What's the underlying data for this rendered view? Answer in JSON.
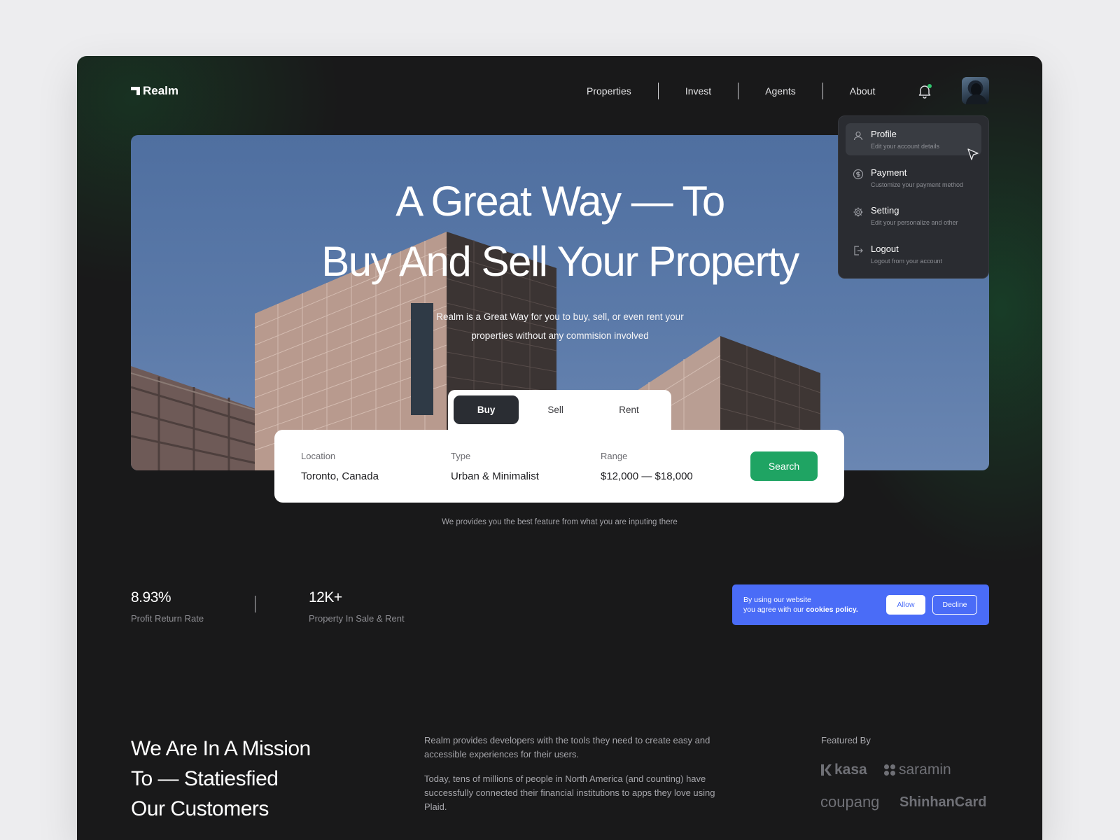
{
  "header": {
    "brand": "Realm",
    "nav": [
      "Properties",
      "Invest",
      "Agents",
      "About"
    ]
  },
  "hero": {
    "title_line1": "A Great Way — To",
    "title_line2": "Buy And Sell Your Property",
    "subtitle": "Realm is a Great Way for you to buy, sell, or even rent your properties without any commision involved"
  },
  "search": {
    "tabs": [
      "Buy",
      "Sell",
      "Rent"
    ],
    "active_tab": "Buy",
    "location_label": "Location",
    "location_value": "Toronto, Canada",
    "type_label": "Type",
    "type_value": "Urban & Minimalist",
    "range_label": "Range",
    "range_value": "$12,000 — $18,000",
    "button": "Search",
    "note": "We provides you the best feature from what you are inputing there"
  },
  "menu": {
    "items": [
      {
        "title": "Profile",
        "desc": "Edit your account details",
        "icon": "user-icon"
      },
      {
        "title": "Payment",
        "desc": "Customize your payment method",
        "icon": "dollar-icon"
      },
      {
        "title": "Setting",
        "desc": "Edit your personalize and other",
        "icon": "gear-icon"
      },
      {
        "title": "Logout",
        "desc": "Logout from your account",
        "icon": "logout-icon"
      }
    ]
  },
  "stats": [
    {
      "value": "8.93%",
      "label": "Profit Return Rate"
    },
    {
      "value": "12K+",
      "label": "Property In Sale & Rent"
    }
  ],
  "cookie": {
    "line1": "By using our website",
    "line2_prefix": "you agree with our ",
    "line2_bold": "cookies policy.",
    "allow": "Allow",
    "decline": "Decline"
  },
  "mission": {
    "line1": "We Are In A Mission",
    "line2": "To — Statiesfied",
    "line3": "Our Customers",
    "p1": "Realm provides developers with the tools they need to create easy and accessible experiences for their users.",
    "p2": "Today, tens of millions of people in North America (and counting) have successfully connected their financial institutions to apps they love using Plaid."
  },
  "featured": {
    "label": "Featured By",
    "brands": [
      "kasa",
      "saramin",
      "coupang",
      "ShinhanCard"
    ]
  },
  "colors": {
    "accent_green": "#1fa463",
    "cookie_blue": "#4a6cf7",
    "background": "#19191a"
  }
}
